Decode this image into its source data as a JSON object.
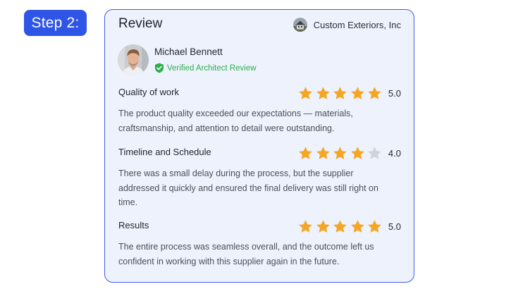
{
  "step_label": "Step 2:",
  "review": {
    "title": "Review",
    "company": {
      "name": "Custom Exteriors, Inc",
      "logo_icon": "house-photo-icon"
    },
    "reviewer": {
      "name": "Michael Bennett",
      "badge_label": "Verified Architect Review",
      "badge_icon": "shield-check-icon"
    },
    "sections": [
      {
        "title": "Quality of work",
        "rating": 5,
        "score_label": "5.0",
        "text": "The product quality exceeded our expectations — materials, craftsmanship, and attention to detail were outstanding."
      },
      {
        "title": "Timeline and Schedule",
        "rating": 4,
        "score_label": "4.0",
        "text": "There was a small delay during the process, but the supplier addressed it quickly and ensured the final delivery was still right on time."
      },
      {
        "title": "Results",
        "rating": 5,
        "score_label": "5.0",
        "text": "The entire process was seamless overall, and the outcome left us confident in working with this supplier again in the future."
      }
    ],
    "max_rating": 5
  },
  "colors": {
    "accent": "#2f55e6",
    "card_background": "#eef2fd",
    "card_border": "#3d5ce8",
    "star_filled": "#f5a623",
    "star_empty": "#cfd3da",
    "verified_green": "#2fae4e"
  }
}
